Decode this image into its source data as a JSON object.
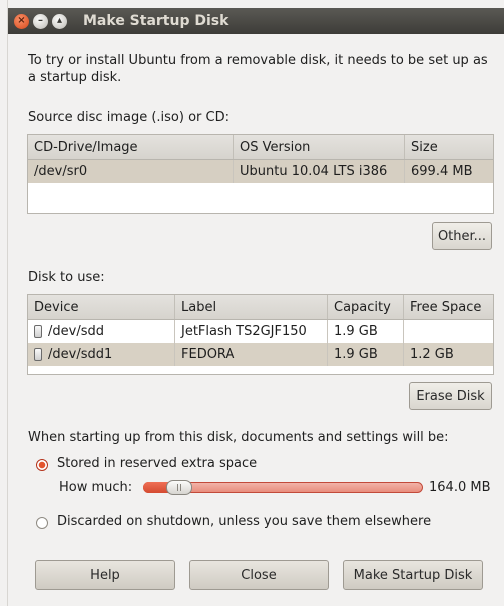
{
  "window": {
    "title": "Make Startup Disk",
    "controls": [
      "close-icon",
      "minimize-icon",
      "maximize-icon"
    ]
  },
  "intro": "To try or install Ubuntu from a removable disk, it needs to be set up as a startup disk.",
  "source": {
    "label": "Source disc image (.iso) or CD:",
    "columns": [
      "CD-Drive/Image",
      "OS Version",
      "Size"
    ],
    "rows": [
      {
        "drive": "/dev/sr0",
        "os_version": "Ubuntu 10.04 LTS i386",
        "size": "699.4 MB"
      }
    ],
    "other_button": "Other..."
  },
  "disk": {
    "label": "Disk to use:",
    "columns": [
      "Device",
      "Label",
      "Capacity",
      "Free Space"
    ],
    "rows": [
      {
        "device": "/dev/sdd",
        "label": "JetFlash TS2GJF150",
        "capacity": "1.9 GB",
        "free_space": ""
      },
      {
        "device": "/dev/sdd1",
        "label": "FEDORA",
        "capacity": "1.9 GB",
        "free_space": "1.2 GB"
      }
    ],
    "erase_button": "Erase Disk"
  },
  "options": {
    "prompt": "When starting up from this disk, documents and settings will be:",
    "stored_label": "Stored in reserved extra space",
    "stored_selected": true,
    "how_much_label": "How much:",
    "how_much_value": "164.0 MB",
    "discard_label": "Discarded on shutdown, unless you save them elsewhere",
    "discard_selected": false
  },
  "buttons": {
    "help": "Help",
    "close": "Close",
    "make": "Make Startup Disk"
  },
  "colors": {
    "titlebar": "#3d3c38",
    "accent": "#e3532d",
    "window_bg": "#f2f1f0"
  }
}
